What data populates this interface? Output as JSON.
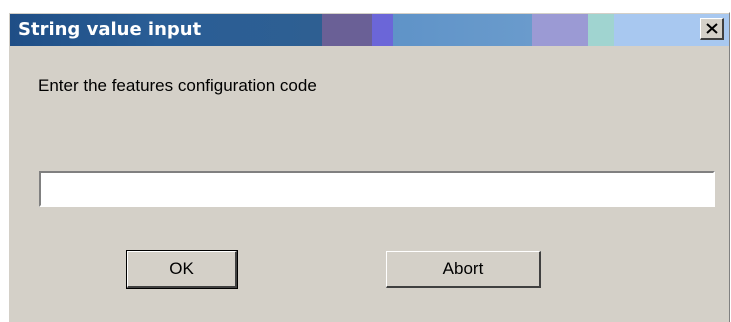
{
  "window": {
    "title": "String value input",
    "close_glyph": "×"
  },
  "dialog": {
    "prompt": "Enter the features configuration code",
    "input_value": "",
    "ok_label": "OK",
    "abort_label": "Abort"
  },
  "icons": {
    "close": "close-icon"
  },
  "colors": {
    "face": "#d4d0c8",
    "title_text": "#ffffff"
  }
}
